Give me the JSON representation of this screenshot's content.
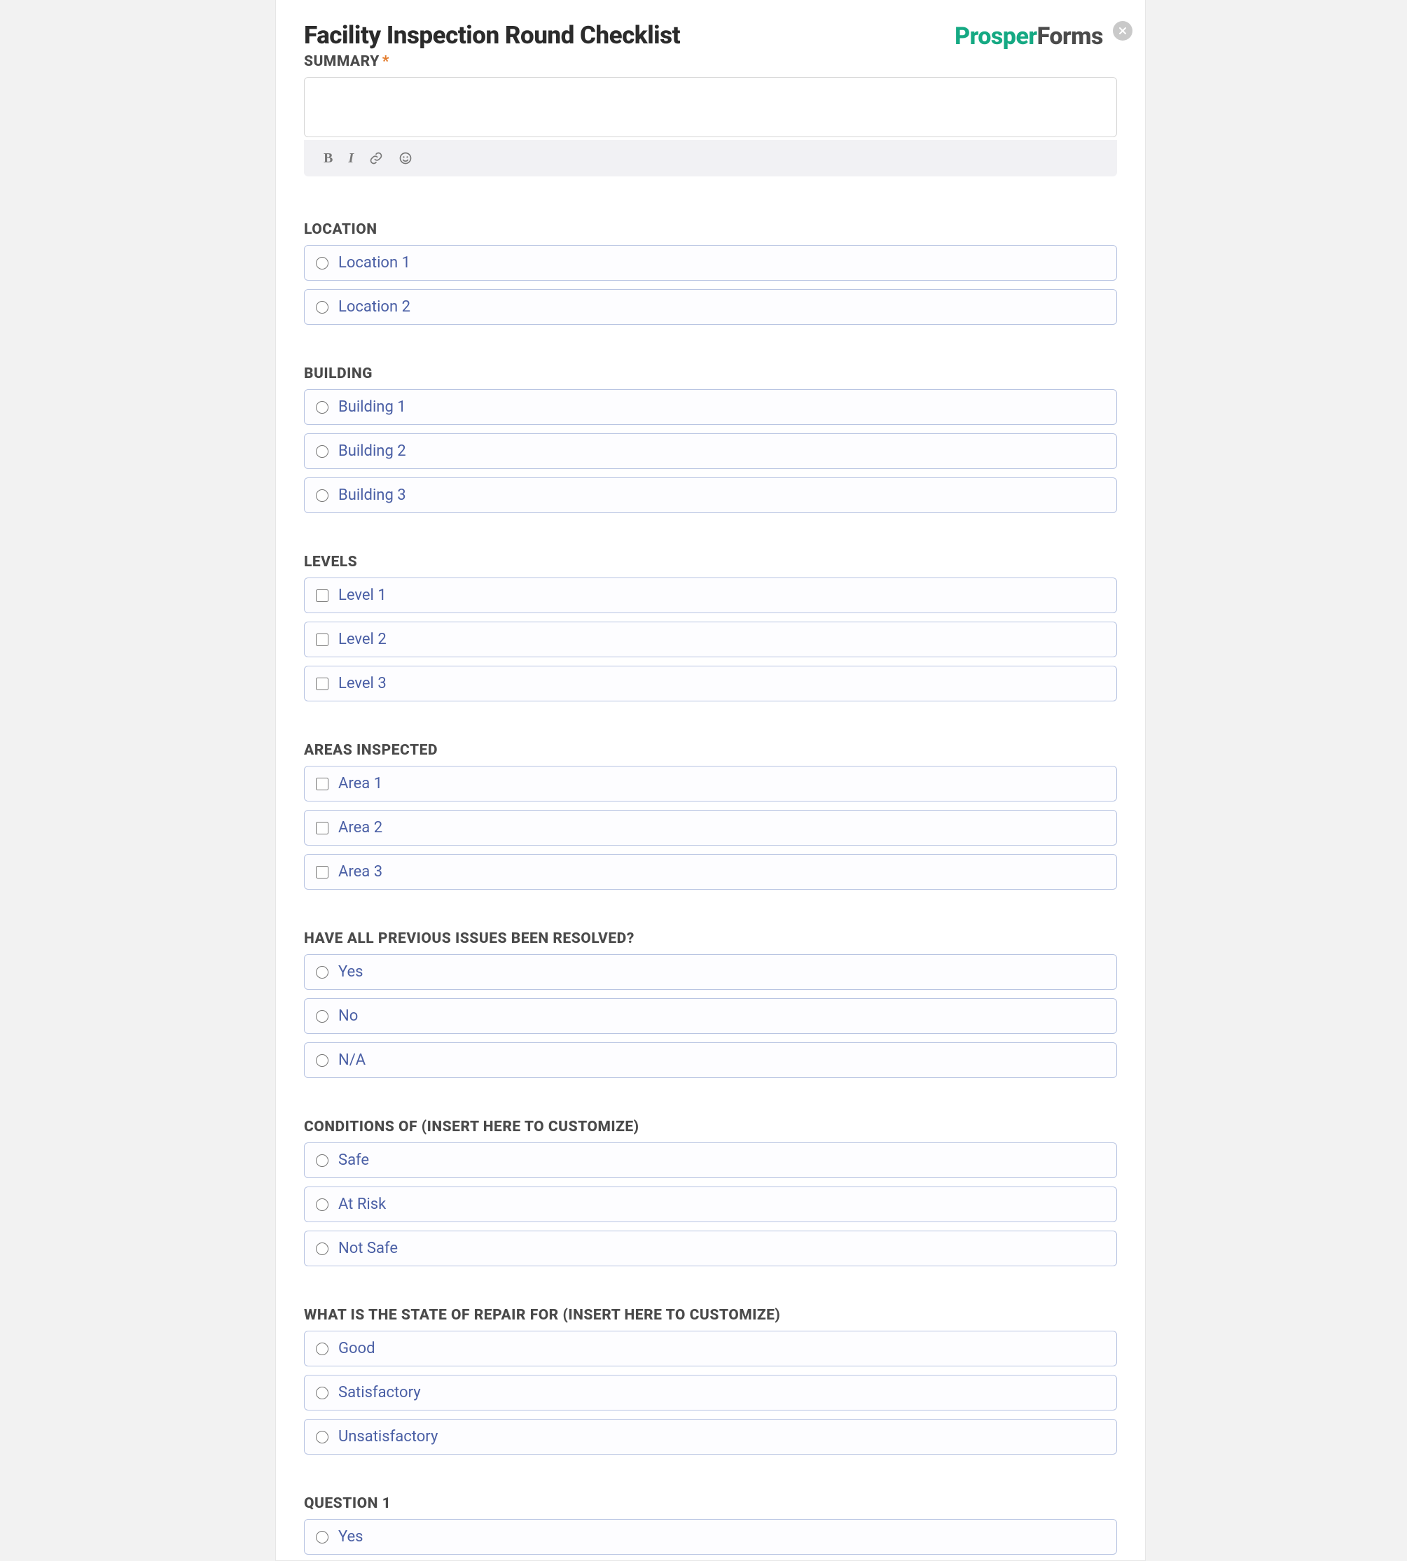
{
  "header": {
    "title": "Facility Inspection Round Checklist",
    "brand_part1": "Prosper",
    "brand_part2": "Forms"
  },
  "summary": {
    "label": "SUMMARY",
    "required_marker": "*",
    "value": ""
  },
  "toolbar": {
    "bold": "B",
    "italic": "I"
  },
  "questions": [
    {
      "heading": "LOCATION",
      "type": "radio",
      "options": [
        "Location 1",
        "Location 2"
      ]
    },
    {
      "heading": "BUILDING",
      "type": "radio",
      "options": [
        "Building 1",
        "Building 2",
        "Building 3"
      ]
    },
    {
      "heading": "LEVELS",
      "type": "checkbox",
      "options": [
        "Level 1",
        "Level 2",
        "Level 3"
      ]
    },
    {
      "heading": "AREAS INSPECTED",
      "type": "checkbox",
      "options": [
        "Area 1",
        "Area 2",
        "Area 3"
      ]
    },
    {
      "heading": "HAVE ALL PREVIOUS ISSUES BEEN RESOLVED?",
      "type": "radio",
      "options": [
        "Yes",
        "No",
        "N/A"
      ]
    },
    {
      "heading": "CONDITIONS OF (INSERT HERE TO CUSTOMIZE)",
      "type": "radio",
      "options": [
        "Safe",
        "At Risk",
        "Not Safe"
      ]
    },
    {
      "heading": "WHAT IS THE STATE OF REPAIR FOR (INSERT HERE TO CUSTOMIZE)",
      "type": "radio",
      "options": [
        "Good",
        "Satisfactory",
        "Unsatisfactory"
      ]
    },
    {
      "heading": "QUESTION 1",
      "type": "radio",
      "options": [
        "Yes"
      ]
    }
  ]
}
